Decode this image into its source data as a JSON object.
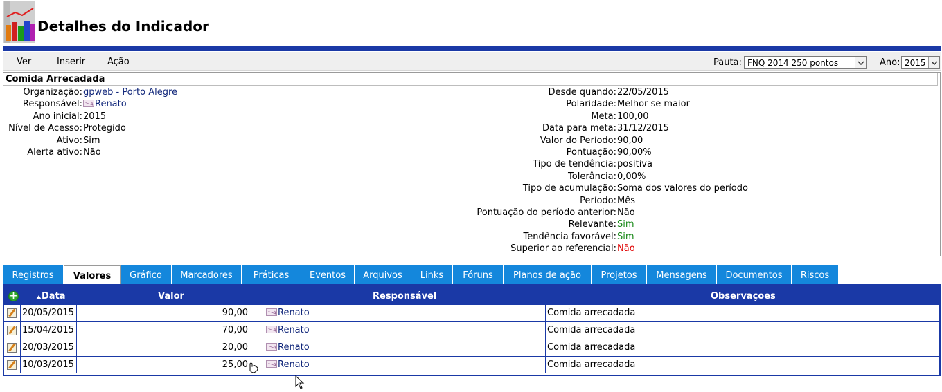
{
  "page_title": "Detalhes do Indicador",
  "menu": [
    "Ver",
    "Inserir",
    "Ação"
  ],
  "filters": {
    "pauta_label": "Pauta:",
    "pauta_value": "FNQ 2014 250 pontos",
    "ano_label": "Ano:",
    "ano_value": "2015"
  },
  "indicator": {
    "name": "Comida Arrecadada",
    "left": [
      {
        "label": "Organização:",
        "value": "gpweb - Porto Alegre",
        "style": "link"
      },
      {
        "label": "Responsável:",
        "value": "Renato",
        "style": "person"
      },
      {
        "label": "Ano inicial:",
        "value": "2015",
        "style": ""
      },
      {
        "label": "Nível de Acesso:",
        "value": "Protegido",
        "style": ""
      },
      {
        "label": "Ativo:",
        "value": "Sim",
        "style": ""
      },
      {
        "label": "Alerta ativo:",
        "value": "Não",
        "style": ""
      }
    ],
    "right": [
      {
        "label": "Desde quando:",
        "value": "22/05/2015",
        "style": ""
      },
      {
        "label": "Polaridade:",
        "value": "Melhor se maior",
        "style": ""
      },
      {
        "label": "Meta:",
        "value": "100,00",
        "style": ""
      },
      {
        "label": "Data para meta:",
        "value": "31/12/2015",
        "style": ""
      },
      {
        "label": "Valor do Período:",
        "value": "90,00",
        "style": ""
      },
      {
        "label": "Pontuação:",
        "value": "90,00%",
        "style": ""
      },
      {
        "label": "Tipo de tendência:",
        "value": "positiva",
        "style": ""
      },
      {
        "label": "Tolerância:",
        "value": "0,00%",
        "style": ""
      },
      {
        "label": "Tipo de acumulação:",
        "value": "Soma dos valores do período",
        "style": ""
      },
      {
        "label": "Período:",
        "value": "Mês",
        "style": ""
      },
      {
        "label": "Pontuação do período anterior:",
        "value": "Não",
        "style": ""
      },
      {
        "label": "Relevante:",
        "value": "Sim",
        "style": "green"
      },
      {
        "label": "Tendência favorável:",
        "value": "Sim",
        "style": "green"
      },
      {
        "label": "Superior ao referencial:",
        "value": "Não",
        "style": "red"
      }
    ]
  },
  "tabs": [
    {
      "label": "Registros",
      "active": false
    },
    {
      "label": "Valores",
      "active": true
    },
    {
      "label": "Gráfico",
      "active": false
    },
    {
      "label": "Marcadores",
      "active": false
    },
    {
      "label": "Práticas",
      "active": false
    },
    {
      "label": "Eventos",
      "active": false
    },
    {
      "label": "Arquivos",
      "active": false
    },
    {
      "label": "Links",
      "active": false
    },
    {
      "label": "Fóruns",
      "active": false
    },
    {
      "label": "Planos de ação",
      "active": false
    },
    {
      "label": "Projetos",
      "active": false
    },
    {
      "label": "Mensagens",
      "active": false
    },
    {
      "label": "Documentos",
      "active": false
    },
    {
      "label": "Riscos",
      "active": false
    }
  ],
  "table": {
    "headers": {
      "data": "Data",
      "valor": "Valor",
      "responsavel": "Responsável",
      "observacoes": "Observações"
    },
    "rows": [
      {
        "data": "20/05/2015",
        "valor": "90,00",
        "responsavel": "Renato",
        "observacoes": "Comida arrecadada"
      },
      {
        "data": "15/04/2015",
        "valor": "70,00",
        "responsavel": "Renato",
        "observacoes": "Comida arrecadada"
      },
      {
        "data": "20/03/2015",
        "valor": "20,00",
        "responsavel": "Renato",
        "observacoes": "Comida arrecadada"
      },
      {
        "data": "10/03/2015",
        "valor": "25,00",
        "responsavel": "Renato",
        "observacoes": "Comida arrecadada"
      }
    ]
  },
  "colors": {
    "brand_blue": "#1a39a6",
    "tab_blue": "#1487dc",
    "link": "#10267a",
    "green": "#1a8a1a",
    "red": "#e00000"
  }
}
